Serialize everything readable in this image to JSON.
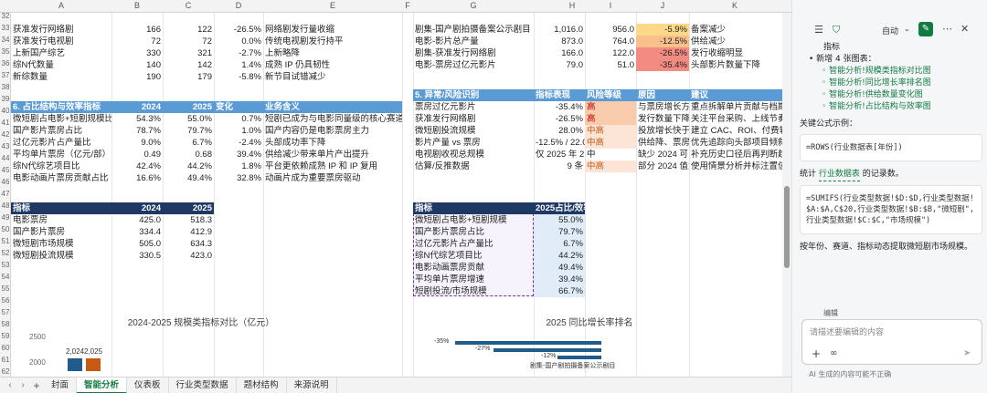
{
  "sheet": {
    "columns": [
      "A",
      "B",
      "C",
      "D",
      "E",
      "F",
      "G",
      "H",
      "I",
      "J",
      "K"
    ],
    "rows_left_top": [
      {
        "rn": "32",
        "a": "获准发行网络剧",
        "b": "166",
        "c": "122",
        "d": "-26.5%",
        "e": "网络剧发行量收缩"
      },
      {
        "rn": "33",
        "a": "获准发行电视剧",
        "b": "72",
        "c": "72",
        "d": "0.0%",
        "e": "传统电视剧发行持平"
      },
      {
        "rn": "34",
        "a": "上新国产综艺",
        "b": "330",
        "c": "321",
        "d": "-2.7%",
        "e": "上新略降"
      },
      {
        "rn": "35",
        "a": "综N代数量",
        "b": "140",
        "c": "142",
        "d": "1.4%",
        "e": "成熟 IP 仍具韧性"
      },
      {
        "rn": "36",
        "a": "新综数量",
        "b": "190",
        "c": "179",
        "d": "-5.8%",
        "e": "新节目试错减少"
      }
    ],
    "section6": {
      "header": [
        "6. 占比结构与效率指标",
        "2024",
        "2025",
        "变化",
        "业务含义"
      ],
      "rows": [
        {
          "a": "微短剧占电影+短剧规模比",
          "b": "54.3%",
          "c": "55.0%",
          "d": "0.7%",
          "e": "短剧已成为与电影同量级的核心赛道"
        },
        {
          "a": "国产影片票房占比",
          "b": "78.7%",
          "c": "79.7%",
          "d": "1.0%",
          "e": "国产内容仍是电影票房主力"
        },
        {
          "a": "过亿元影片占产量比",
          "b": "9.0%",
          "c": "6.7%",
          "d": "-2.4%",
          "e": "头部成功率下降"
        },
        {
          "a": "平均单片票房（亿元/部）",
          "b": "0.49",
          "c": "0.68",
          "d": "39.4%",
          "e": "供给减少带来单片产出提升"
        },
        {
          "a": "综N代综艺项目比",
          "b": "42.4%",
          "c": "44.2%",
          "d": "1.8%",
          "e": "平台更依赖成熟 IP 和 IP 复用"
        },
        {
          "a": "电影动画片票房贡献占比",
          "b": "16.6%",
          "c": "49.4%",
          "d": "32.8%",
          "e": "动画片成为重要票房驱动"
        }
      ]
    },
    "table_left_bottom": {
      "header": [
        "指标",
        "2024",
        "2025"
      ],
      "rows": [
        {
          "a": "电影票房",
          "b": "425.0",
          "c": "518.3"
        },
        {
          "a": "国产影片票房",
          "b": "334.4",
          "c": "412.9"
        },
        {
          "a": "微短剧市场规模",
          "b": "505.0",
          "c": "634.3"
        },
        {
          "a": "微短剧投流规模",
          "b": "330.5",
          "c": "423.0"
        }
      ]
    },
    "rows_right_top": [
      {
        "g": "剧集-国产剧拍摄备案公示剧目",
        "h": "1,016.0",
        "i": "956.0",
        "j": "-5.9%",
        "k": "备案减少"
      },
      {
        "g": "电影-影片总产量",
        "h": "873.0",
        "i": "764.0",
        "j": "-12.5%",
        "k": "供给减少"
      },
      {
        "g": "剧集-获准发行网络剧",
        "h": "166.0",
        "i": "122.0",
        "j": "-26.5%",
        "k": "发行收缩明显"
      },
      {
        "g": "电影-票房过亿元影片",
        "h": "79.0",
        "i": "51.0",
        "j": "-35.4%",
        "k": "头部影片数量下降"
      }
    ],
    "section5": {
      "header": [
        "5. 异常/风险识别",
        "指标表现",
        "风险等级",
        "原因",
        "建议"
      ],
      "rows": [
        {
          "g": "票房过亿元影片",
          "h": "-35.4%",
          "i": "高",
          "j": "与票房增长方向",
          "k": "重点拆解单片贡献与档期集中度"
        },
        {
          "g": "获准发行网络剧",
          "h": "-26.5%",
          "i": "高",
          "j": "发行数量下降超",
          "k": "关注平台采购、上线节奏和库存"
        },
        {
          "g": "微短剧投流规模",
          "h": "28.0%",
          "i": "中高",
          "j": "投放增长快于规",
          "k": "建立 CAC、ROI、付费转化追踪"
        },
        {
          "g": "影片产量 vs 票房",
          "h": "-12.5% / 22.0%",
          "i": "中高",
          "j": "供给降、票房升",
          "k": "优先追踪向头部项目倾斜"
        },
        {
          "g": "电视剧收视总规模",
          "h": "仅 2025 年 2.5(",
          "i": "中",
          "j": "缺少 2024 可比",
          "k": "补充历史口径后再判断趋势"
        },
        {
          "g": "估算/反推数据",
          "h": "9 条",
          "i": "中高",
          "j": "部分 2024 值为",
          "k": "使用情景分析并标注置信度"
        }
      ]
    },
    "table_right_bottom": {
      "header": [
        "指标",
        "2025占比/效率"
      ],
      "rows": [
        {
          "g": "微短剧占电影+短剧规模",
          "h": "55.0%"
        },
        {
          "g": "国产影片票房占比",
          "h": "79.7%"
        },
        {
          "g": "过亿元影片占产量比",
          "h": "6.7%"
        },
        {
          "g": "综N代综艺项目比",
          "h": "44.2%"
        },
        {
          "g": "电影动画票房贡献",
          "h": "49.4%"
        },
        {
          "g": "平均单片票房增速",
          "h": "39.4%"
        },
        {
          "g": "短剧投流/市场规模",
          "h": "66.7%"
        }
      ]
    },
    "row_numbers": [
      "32",
      "33",
      "34",
      "35",
      "36",
      "37",
      "38",
      "39",
      "40",
      "41",
      "42",
      "43",
      "44",
      "45",
      "46",
      "47",
      "48",
      "49",
      "50",
      "51",
      "52",
      "53",
      "54",
      "55",
      "56",
      "57",
      "58",
      "59",
      "60",
      "61",
      "62",
      "63"
    ]
  },
  "charts": {
    "left": {
      "title": "2024-2025 规模类指标对比（亿元）",
      "y_ticks": [
        "2500",
        "2000"
      ],
      "bar_labels": [
        "2,024",
        "2,025"
      ]
    },
    "right": {
      "title": "2025 同比增长率排名",
      "bar_labels": [
        "-35%",
        "-27%",
        "-12%"
      ],
      "category_label": "剧集-国产剧拍摄备案公示剧目"
    }
  },
  "tabs": {
    "items": [
      "封面",
      "智能分析",
      "仪表板",
      "行业类型数据",
      "题材结构",
      "来源说明"
    ],
    "active_index": 1
  },
  "pane": {
    "mode_label": "自动",
    "intro_text": "指标",
    "new_charts_line": "• 新增 4 张图表：",
    "chart_links": [
      "智能分析!规模类指标对比图",
      "智能分析!同比增长率排名图",
      "智能分析!供给数量变化图",
      "智能分析!占比结构与效率图"
    ],
    "formula_heading": "关键公式示例：",
    "formula1": "=ROWS(行业数据表[年份])",
    "stat_text_a": "统计",
    "stat_chip": "行业数据表",
    "stat_text_b": "的记录数。",
    "formula2": "=SUMIFS(行业类型数据!$D:$D,行业类型数据!$A:$A,C$20,行业类型数据!$B:$B,\"微短剧\",行业类型数据!$C:$C,\"市场规模\")",
    "formula2_desc": "按年份、赛道、指标动态提取微短剧市场规模。",
    "edit_label": "编辑",
    "input_placeholder": "请描述要编辑的内容",
    "disclaimer": "AI 生成的内容可能不正确",
    "accent": "#107c41"
  }
}
